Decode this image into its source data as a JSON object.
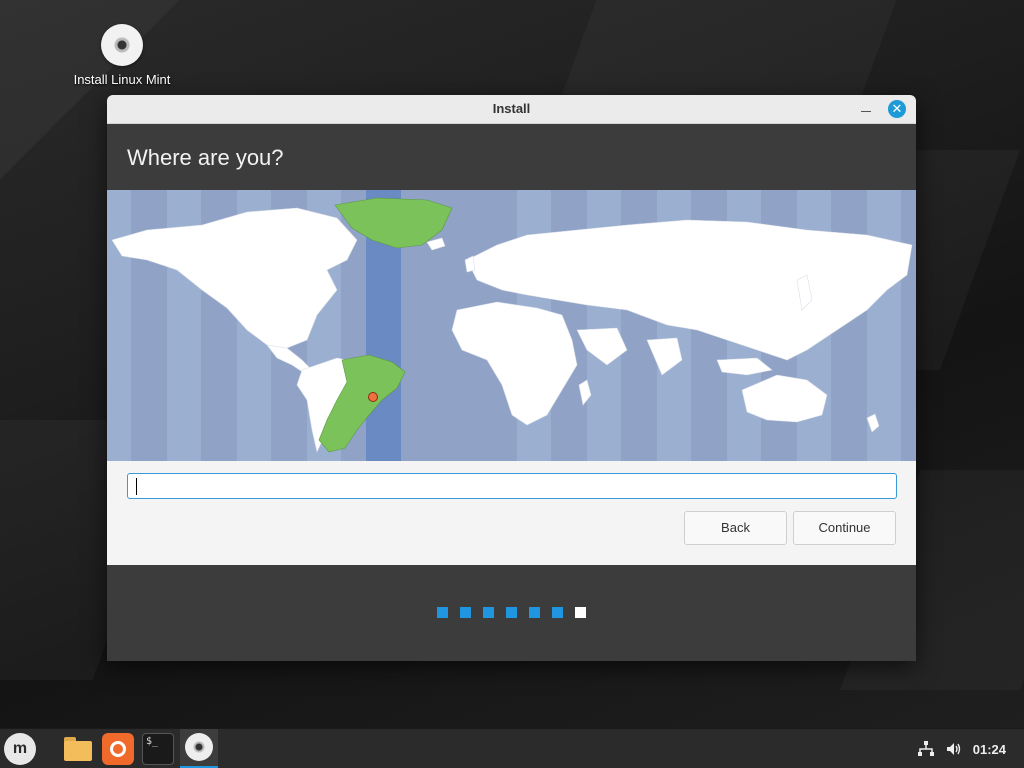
{
  "desktop": {
    "icon_label": "Install Linux Mint"
  },
  "window": {
    "title": "Install",
    "heading": "Where are you?",
    "timezone_input": {
      "value": "",
      "placeholder": ""
    },
    "buttons": {
      "back": "Back",
      "continue": "Continue"
    },
    "progress": {
      "total_steps": 7,
      "current_step": 7
    },
    "selected_location_marker": "red-dot",
    "highlight_color": "#7cc25a",
    "accent_color": "#2196e0"
  },
  "taskbar": {
    "apps": [
      "menu-icon",
      "files-icon",
      "firefox-icon",
      "terminal-icon",
      "installer-icon"
    ],
    "clock": "01:24",
    "tray": [
      "network-icon",
      "volume-icon"
    ]
  }
}
